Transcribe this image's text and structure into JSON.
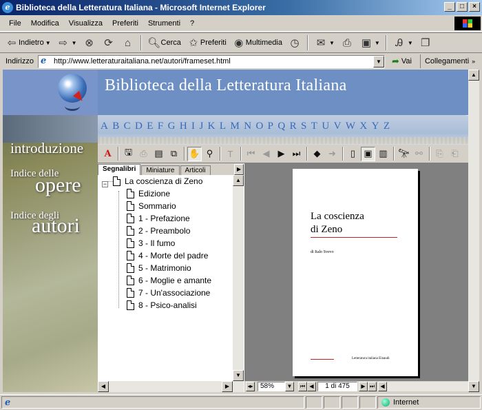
{
  "window": {
    "title": "Biblioteca della Letteratura Italiana - Microsoft Internet Explorer"
  },
  "menu": [
    "File",
    "Modifica",
    "Visualizza",
    "Preferiti",
    "Strumenti",
    "?"
  ],
  "toolbar": {
    "back": "Indietro",
    "search": "Cerca",
    "favorites": "Preferiti",
    "media": "Multimedia"
  },
  "address": {
    "label": "Indirizzo",
    "url": "http://www.letteraturaitaliana.net/autori/frameset.html",
    "go": "Vai",
    "links": "Collegamenti"
  },
  "site": {
    "title": "Biblioteca della Letteratura Italiana",
    "alphabet": [
      "A",
      "B",
      "C",
      "D",
      "E",
      "F",
      "G",
      "H",
      "I",
      "J",
      "K",
      "L",
      "M",
      "N",
      "O",
      "P",
      "Q",
      "R",
      "S",
      "T",
      "U",
      "V",
      "W",
      "X",
      "Y",
      "Z"
    ],
    "nav": {
      "intro": "introduzione",
      "opere_small": "Indice delle",
      "opere_big": "opere",
      "autori_small": "Indice degli",
      "autori_big": "autori"
    }
  },
  "reader": {
    "tabs": [
      "Segnalibri",
      "Miniature",
      "Articoli"
    ],
    "bookmark_root": "La coscienza di Zeno",
    "bookmarks": [
      "Edizione",
      "Sommario",
      "1 - Prefazione",
      "2 - Preambolo",
      "3 - Il fumo",
      "4 - Morte del padre",
      "5 - Matrimonio",
      "6 - Moglie e amante",
      "7 - Un'associazione",
      "8 - Psico-analisi"
    ],
    "page": {
      "title_line1": "La coscienza",
      "title_line2": "di Zeno",
      "author": "di Italo Svevo",
      "publisher": "Letteratura italiana Einaudi"
    },
    "zoom": "58%",
    "page_indicator": "1 di 475"
  },
  "status": {
    "zone": "Internet"
  }
}
